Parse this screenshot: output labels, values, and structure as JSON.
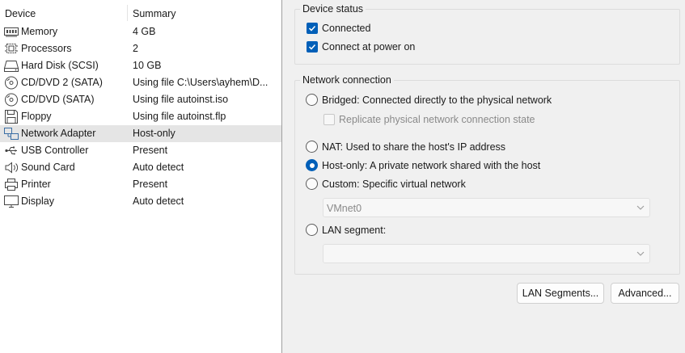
{
  "device_list": {
    "headers": {
      "device": "Device",
      "summary": "Summary"
    },
    "rows": [
      {
        "icon": "memory-icon",
        "device": "Memory",
        "summary": "4 GB"
      },
      {
        "icon": "processor-icon",
        "device": "Processors",
        "summary": "2"
      },
      {
        "icon": "hard-disk-icon",
        "device": "Hard Disk (SCSI)",
        "summary": "10 GB"
      },
      {
        "icon": "cd-dvd-icon",
        "device": "CD/DVD 2 (SATA)",
        "summary": "Using file C:\\Users\\ayhem\\D..."
      },
      {
        "icon": "cd-dvd-icon",
        "device": "CD/DVD (SATA)",
        "summary": "Using file autoinst.iso"
      },
      {
        "icon": "floppy-icon",
        "device": "Floppy",
        "summary": "Using file autoinst.flp"
      },
      {
        "icon": "network-adapter-icon",
        "device": "Network Adapter",
        "summary": "Host-only"
      },
      {
        "icon": "usb-icon",
        "device": "USB Controller",
        "summary": "Present"
      },
      {
        "icon": "speaker-icon",
        "device": "Sound Card",
        "summary": "Auto detect"
      },
      {
        "icon": "printer-icon",
        "device": "Printer",
        "summary": "Present"
      },
      {
        "icon": "monitor-icon",
        "device": "Display",
        "summary": "Auto detect"
      }
    ],
    "selected_device": "Network Adapter"
  },
  "device_status": {
    "title": "Device status",
    "connected": {
      "label": "Connected",
      "checked": true
    },
    "connect_at_power_on": {
      "label": "Connect at power on",
      "checked": true
    }
  },
  "network_connection": {
    "title": "Network connection",
    "bridged": {
      "label": "Bridged: Connected directly to the physical network",
      "selected": false
    },
    "replicate": {
      "label": "Replicate physical network connection state",
      "checked": false,
      "enabled": false
    },
    "nat": {
      "label": "NAT: Used to share the host's IP address",
      "selected": false
    },
    "host_only": {
      "label": "Host-only: A private network shared with the host",
      "selected": true
    },
    "custom": {
      "label": "Custom: Specific virtual network",
      "selected": false
    },
    "custom_network_value": "VMnet0",
    "lan_segment": {
      "label": "LAN segment:",
      "selected": false
    },
    "lan_segment_value": ""
  },
  "buttons": {
    "lan_segments": "LAN Segments...",
    "advanced": "Advanced..."
  },
  "colors": {
    "accent": "#005fb8",
    "selected_row": "#e5e5e5",
    "disabled_text": "#8a8a8a"
  }
}
